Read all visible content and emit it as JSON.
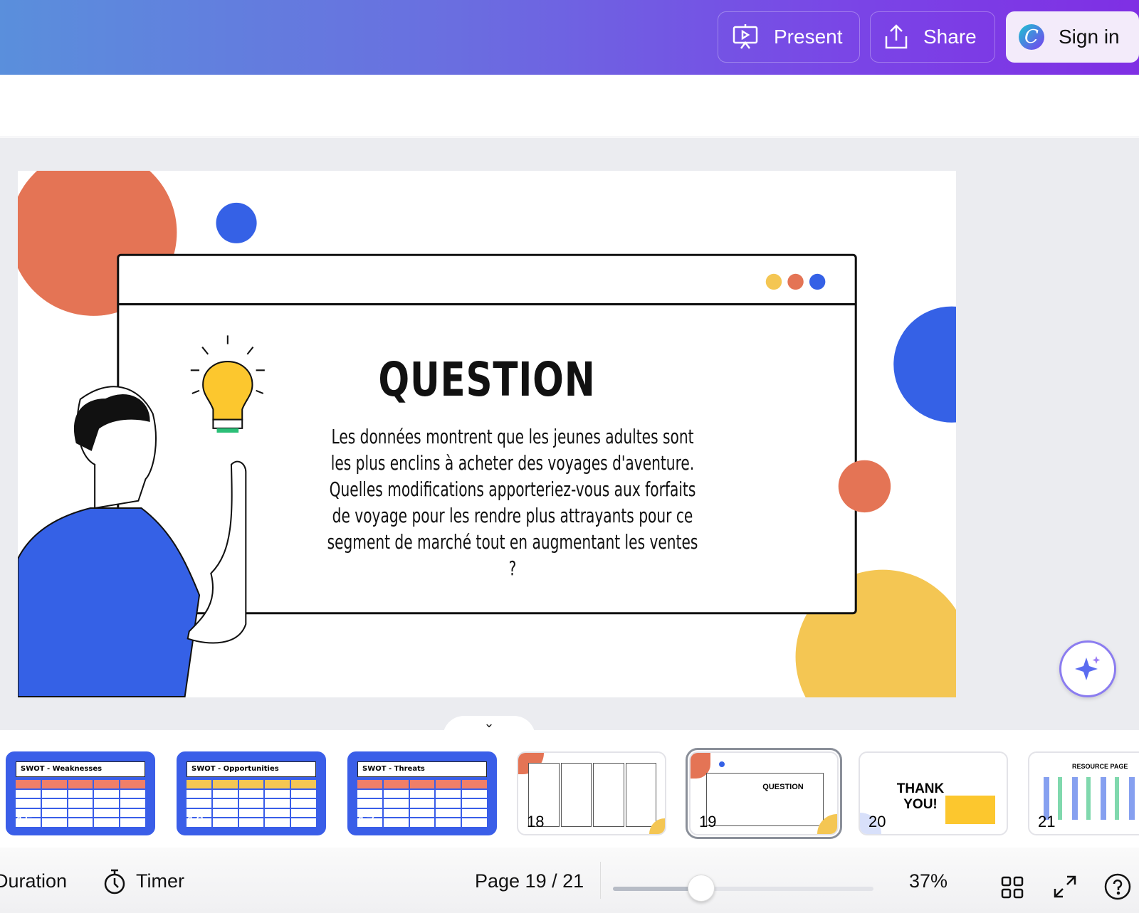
{
  "header": {
    "present_label": "Present",
    "share_label": "Share",
    "signin_label": "Sign in",
    "gradient": [
      "#5a8fdc",
      "#7f2fe4"
    ]
  },
  "slide": {
    "title": "QUESTION",
    "body": "Les données montrent que les jeunes adultes sont les plus enclins à acheter des voyages d'aventure. Quelles modifications apporteriez-vous aux forfaits de voyage pour les rendre plus attrayants pour ce segment de marché tout en augmentant les ventes ?",
    "colors": {
      "orange": "#e47455",
      "blue": "#3561e6",
      "yellow": "#f4c653"
    }
  },
  "thumbnails": [
    {
      "number": "15",
      "title": "SWOT - Weaknesses"
    },
    {
      "number": "16",
      "title": "SWOT - Opportunities"
    },
    {
      "number": "17",
      "title": "SWOT - Threats"
    },
    {
      "number": "18",
      "title": ""
    },
    {
      "number": "19",
      "title": "QUESTION",
      "selected": true
    },
    {
      "number": "20",
      "title": "THANK YOU!"
    },
    {
      "number": "21",
      "title": "RESOURCE PAGE"
    }
  ],
  "footer": {
    "duration_label": "Duration",
    "timer_label": "Timer",
    "page_label": "Page 19 / 21",
    "zoom_label": "37%",
    "zoom_value": 37
  }
}
